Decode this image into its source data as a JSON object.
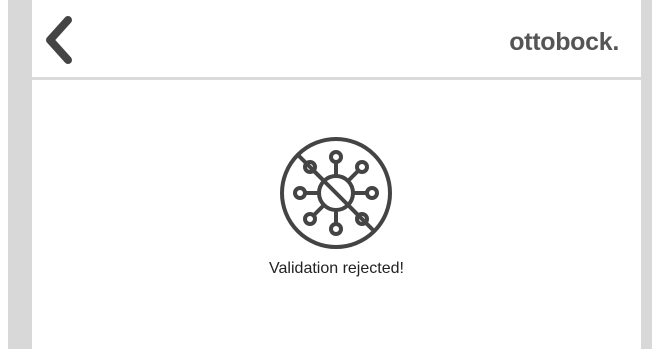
{
  "header": {
    "back_icon": "chevron-left-icon",
    "brand": "ottobock."
  },
  "main": {
    "status_icon": "virus-crossed-out-icon",
    "message": "Validation rejected!"
  },
  "colors": {
    "background_gutter": "#d8d8d8",
    "panel": "#ffffff",
    "divider": "#dadada",
    "icon": "#444444",
    "brand_text": "#555555",
    "text": "#222222"
  }
}
